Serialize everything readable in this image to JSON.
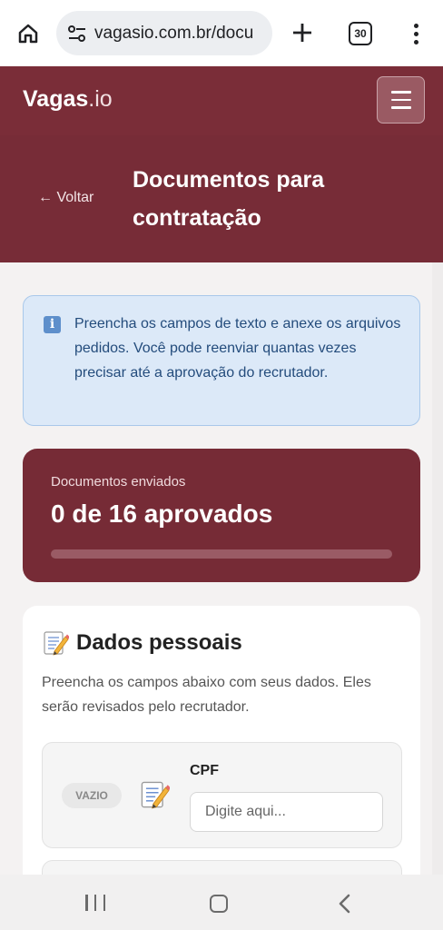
{
  "browser": {
    "url": "vagasio.com.br/docu",
    "tab_count": "30"
  },
  "header": {
    "brand_bold": "Vagas",
    "brand_suffix": ".io"
  },
  "title_band": {
    "back_label": "← Voltar",
    "title": "Documentos para contratação"
  },
  "info": {
    "text": "Preencha os campos de texto e anexe os arquivos pedidos. Você pode reenviar quantas vezes precisar até a aprovação do recrutador."
  },
  "progress": {
    "label": "Documentos enviados",
    "value_text": "0 de 16 aprovados",
    "approved": 0,
    "total": 16
  },
  "section": {
    "title": "Dados pessoais",
    "description": "Preencha os campos abaixo com seus dados. Eles serão revisados pelo recrutador.",
    "fields": [
      {
        "status": "VAZIO",
        "label": "CPF",
        "placeholder": "Digite aqui...",
        "value": ""
      }
    ]
  },
  "colors": {
    "brand": "#7a2d38",
    "info_bg": "#dce9f8",
    "info_text": "#244c7c"
  },
  "icons": {
    "home": "home-icon",
    "site_settings": "tune-icon",
    "new_tab": "plus-icon",
    "info": "info-icon",
    "memo": "memo-icon"
  }
}
